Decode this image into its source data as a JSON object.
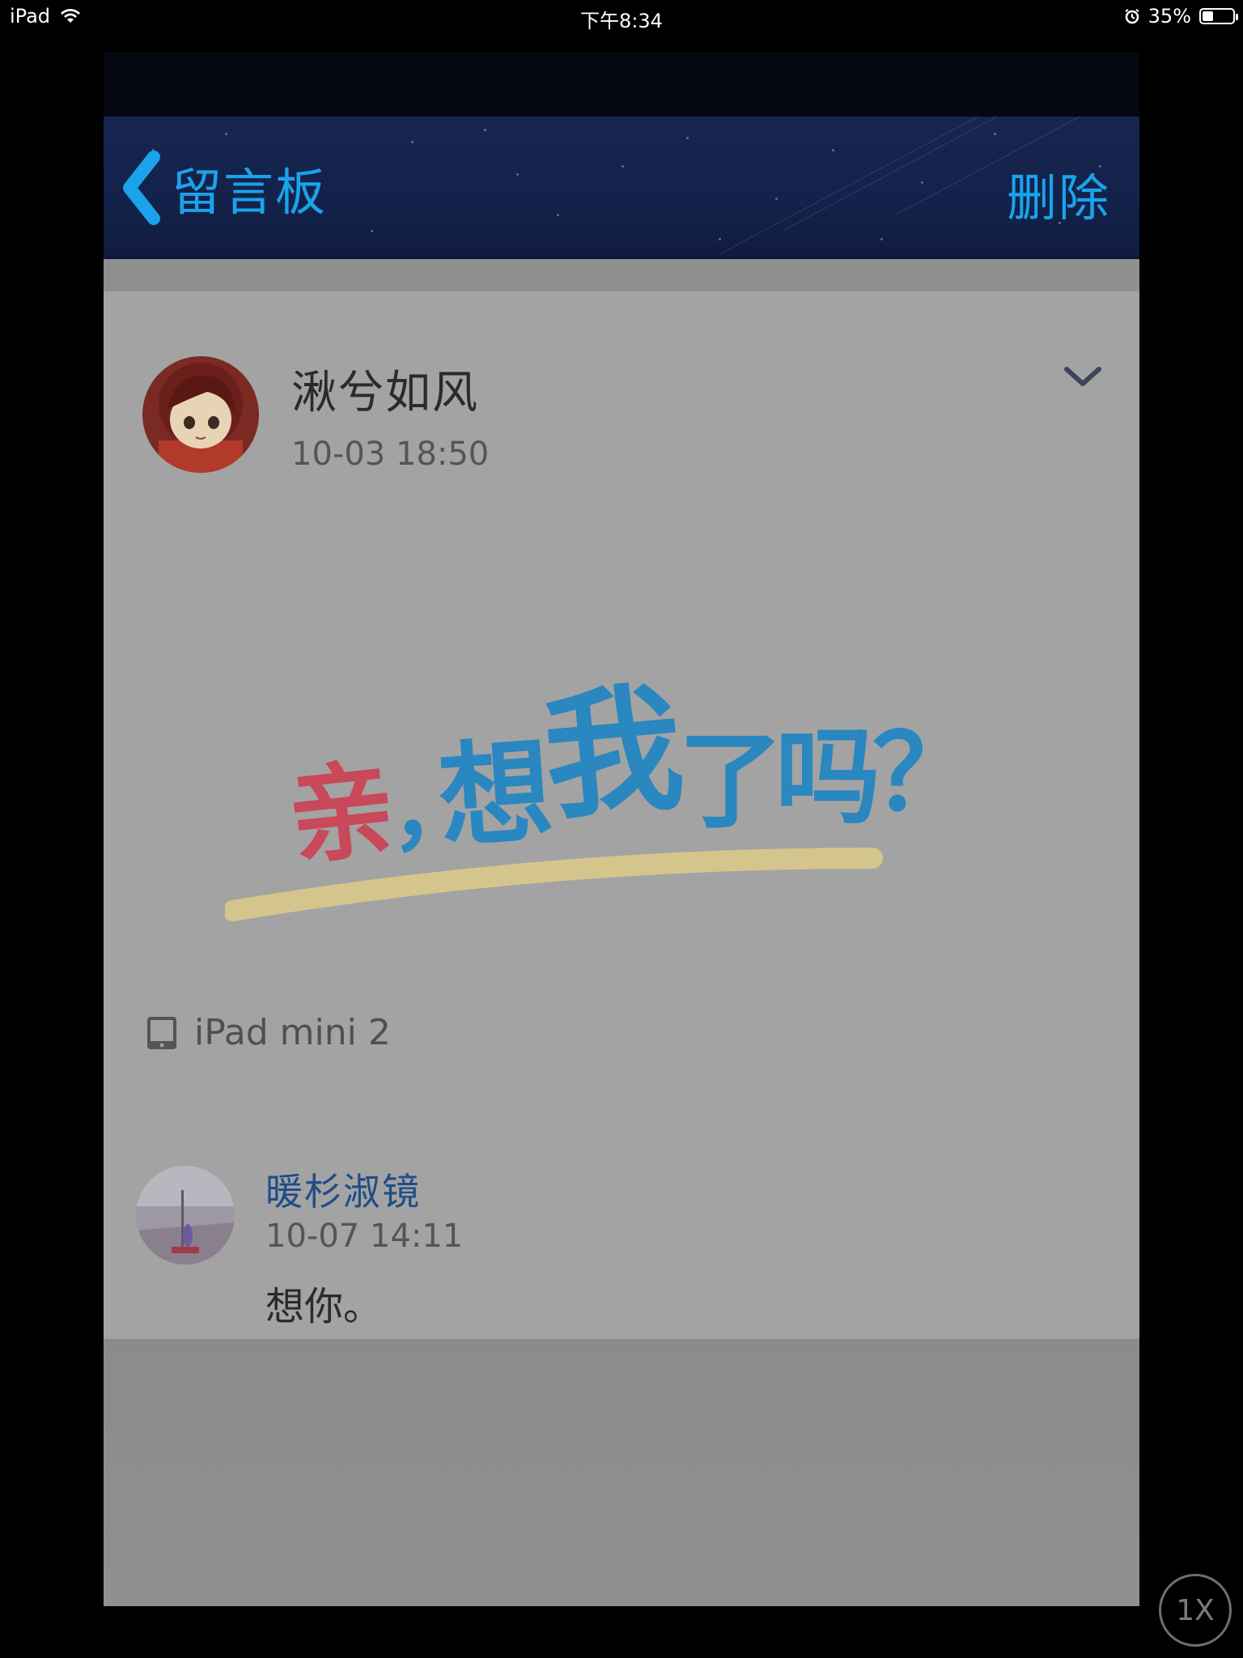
{
  "status_bar": {
    "carrier": "iPad",
    "time": "下午8:34",
    "battery_text": "35%",
    "battery_level": 0.35
  },
  "nav": {
    "back_label": "留言板",
    "delete_label": "删除"
  },
  "post": {
    "author": "湫兮如风",
    "time": "10-03 18:50",
    "sticker_text": [
      "亲",
      "，",
      "想",
      "我",
      "了",
      "吗",
      "？"
    ],
    "device": "iPad mini 2"
  },
  "reply": {
    "author": "暖杉淑镜",
    "time": "10-07 14:11",
    "text": "想你。"
  },
  "zoom_button": {
    "label": "1X"
  },
  "colors": {
    "accent": "#1aa3ea",
    "nav_bg": "#13224a",
    "sticker_red": "#c9485a",
    "sticker_blue": "#2a87c0",
    "sticker_stroke": "#d9c98a"
  }
}
